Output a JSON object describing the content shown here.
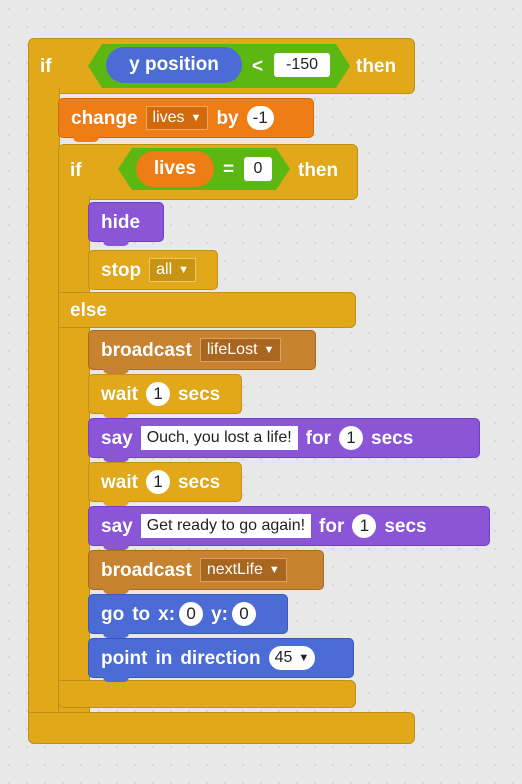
{
  "outer_if": {
    "if_label": "if",
    "reporter": "y position",
    "operator": "<",
    "compare_value": "-150",
    "then_label": "then"
  },
  "change_block": {
    "change_label": "change",
    "variable": "lives",
    "by_label": "by",
    "amount": "-1"
  },
  "inner_if": {
    "if_label": "if",
    "variable": "lives",
    "operator": "=",
    "compare_value": "0",
    "then_label": "then",
    "hide_label": "hide",
    "stop_label": "stop",
    "stop_option": "all",
    "else_label": "else"
  },
  "else_blocks": {
    "broadcast1": {
      "label": "broadcast",
      "message": "lifeLost"
    },
    "wait1": {
      "label": "wait",
      "value": "1",
      "unit": "secs"
    },
    "say1": {
      "label": "say",
      "text": "Ouch, you lost a life!",
      "for_label": "for",
      "value": "1",
      "unit": "secs"
    },
    "wait2": {
      "label": "wait",
      "value": "1",
      "unit": "secs"
    },
    "say2": {
      "label": "say",
      "text": "Get ready to go again!",
      "for_label": "for",
      "value": "1",
      "unit": "secs"
    },
    "broadcast2": {
      "label": "broadcast",
      "message": "nextLife"
    },
    "goto": {
      "go_label": "go",
      "to_label": "to",
      "x_label": "x:",
      "x_value": "0",
      "y_label": "y:",
      "y_value": "0"
    },
    "point": {
      "point_label": "point",
      "in_label": "in",
      "direction_label": "direction",
      "value": "45"
    }
  },
  "colors": {
    "control": "#e1a91a",
    "looks": "#8a55d7",
    "events": "#c88330",
    "variables": "#ee7d16",
    "operators": "#5cb712",
    "motion": "#4a6cd4",
    "sensing": "#4a6cd4"
  }
}
